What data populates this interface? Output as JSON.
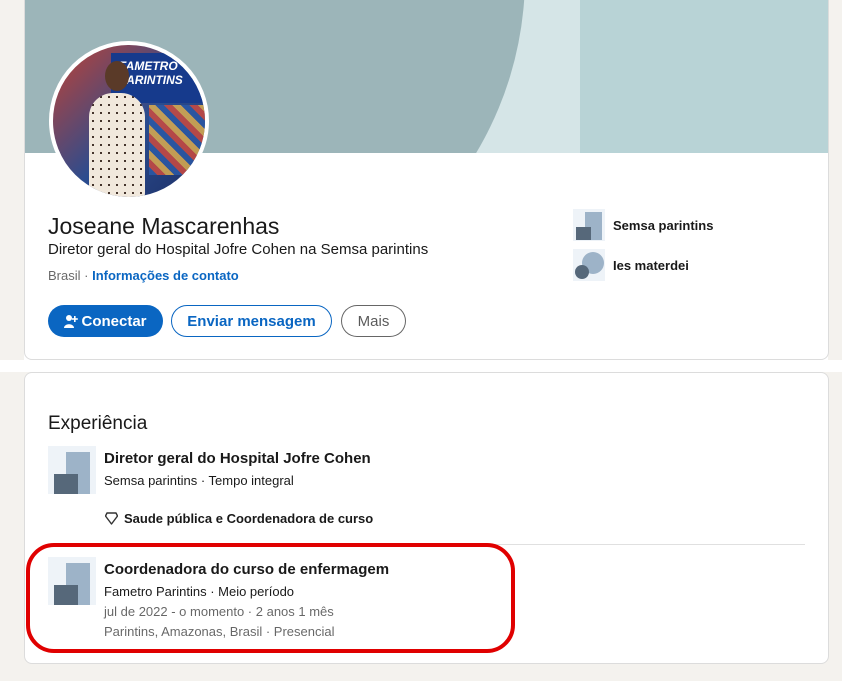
{
  "profile": {
    "name": "Joseane Mascarenhas",
    "headline": "Diretor geral do Hospital Jofre Cohen na Semsa parintins",
    "location": "Brasil",
    "location_separator": "·",
    "contact_link": "Informações de contato",
    "avatar_banner_text": "FAMETRO PARINTINS"
  },
  "actions": {
    "connect_label": "Conectar",
    "message_label": "Enviar mensagem",
    "more_label": "Mais"
  },
  "organizations": [
    {
      "label": "Semsa parintins",
      "icon": "company-logo-icon"
    },
    {
      "label": "Ies materdei",
      "icon": "school-logo-icon"
    }
  ],
  "experience": {
    "section_title": "Experiência",
    "items": [
      {
        "title": "Diretor geral do Hospital Jofre Cohen",
        "company_line": "Semsa parintins · Tempo integral",
        "skills": "Saude pública e Coordenadora de curso"
      },
      {
        "title": "Coordenadora do curso de enfermagem",
        "company_line": "Fametro Parintins · Meio período",
        "date_line": "jul de 2022 - o momento · 2 anos 1 mês",
        "location_line": "Parintins, Amazonas, Brasil · Presencial"
      }
    ]
  },
  "colors": {
    "primary": "#0a66c2",
    "highlight": "#e00000",
    "banner": "#9cb5b9"
  }
}
